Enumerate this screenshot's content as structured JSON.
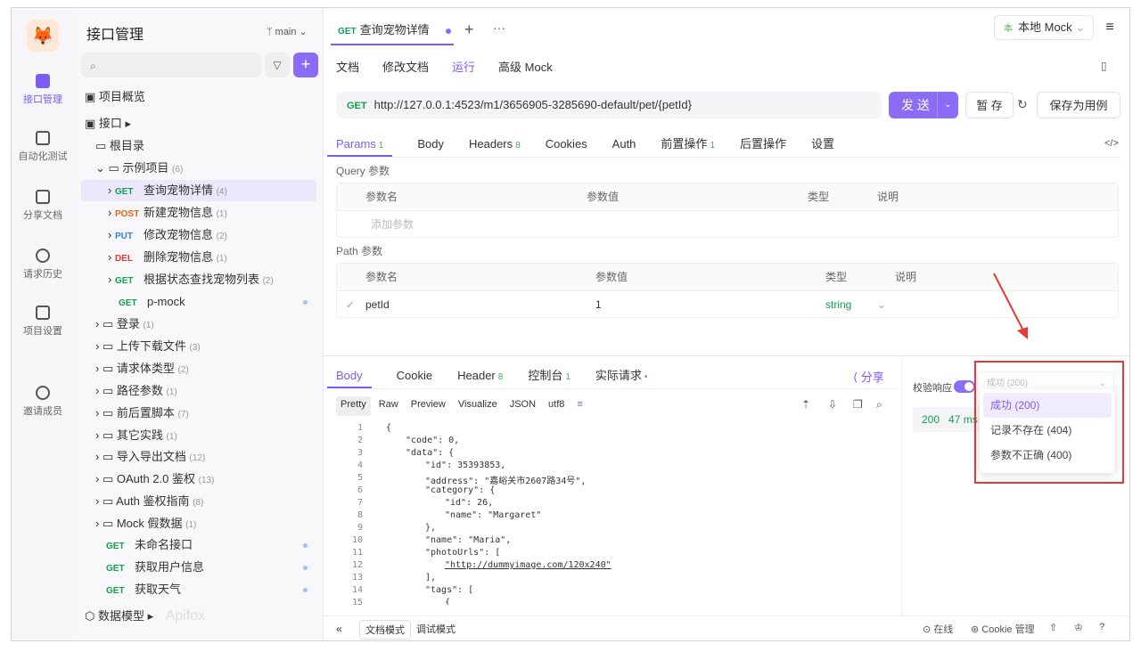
{
  "rail": {
    "items": [
      {
        "label": "接口管理",
        "icon": "api-icon"
      },
      {
        "label": "自动化测试",
        "icon": "automation-icon"
      },
      {
        "label": "分享文档",
        "icon": "share-doc-icon"
      },
      {
        "label": "请求历史",
        "icon": "history-icon"
      },
      {
        "label": "项目设置",
        "icon": "settings-icon"
      },
      {
        "label": "邀请成员",
        "icon": "invite-icon"
      }
    ]
  },
  "sidebar": {
    "title": "接口管理",
    "branch": "main",
    "overview": "项目概览",
    "api_section": "接口",
    "root": "根目录",
    "tree": [
      {
        "label": "示例项目",
        "count": "(6)",
        "type": "folder"
      },
      {
        "method": "GET",
        "label": "查询宠物详情",
        "count": "(4)"
      },
      {
        "method": "POST",
        "label": "新建宠物信息",
        "count": "(1)"
      },
      {
        "method": "PUT",
        "label": "修改宠物信息",
        "count": "(2)"
      },
      {
        "method": "DEL",
        "label": "删除宠物信息",
        "count": "(1)"
      },
      {
        "method": "GET",
        "label": "根据状态查找宠物列表",
        "count": "(2)"
      },
      {
        "method": "GET",
        "label": "p-mock",
        "count": ""
      },
      {
        "label": "登录",
        "count": "(1)"
      },
      {
        "label": "上传下载文件",
        "count": "(3)"
      },
      {
        "label": "请求体类型",
        "count": "(2)"
      },
      {
        "label": "路径参数",
        "count": "(1)"
      },
      {
        "label": "前后置脚本",
        "count": "(7)"
      },
      {
        "label": "其它实践",
        "count": "(1)"
      },
      {
        "label": "导入导出文档",
        "count": "(12)"
      },
      {
        "label": "OAuth 2.0 鉴权",
        "count": "(13)"
      },
      {
        "label": "Auth 鉴权指南",
        "count": "(8)"
      },
      {
        "label": "Mock 假数据",
        "count": "(1)"
      },
      {
        "method": "GET",
        "label": "未命名接口",
        "count": ""
      },
      {
        "method": "GET",
        "label": "获取用户信息",
        "count": ""
      },
      {
        "method": "GET",
        "label": "获取天气",
        "count": ""
      }
    ],
    "data_model": "数据模型",
    "watermark": "Apifox"
  },
  "tab": {
    "method": "GET",
    "label": "查询宠物详情"
  },
  "env": {
    "label": "本地 Mock"
  },
  "subtabs": [
    "文档",
    "修改文档",
    "运行",
    "高级 Mock"
  ],
  "url": {
    "method": "GET",
    "value": "http://127.0.0.1:4523/m1/3656905-3285690-default/pet/{petId}"
  },
  "buttons": {
    "send": "发 送",
    "save": "暂 存",
    "save_case": "保存为用例"
  },
  "reqtabs": [
    {
      "label": "Params",
      "badge": "1"
    },
    {
      "label": "Body",
      "badge": ""
    },
    {
      "label": "Headers",
      "badge": "8"
    },
    {
      "label": "Cookies",
      "badge": ""
    },
    {
      "label": "Auth",
      "badge": ""
    },
    {
      "label": "前置操作",
      "badge": "1"
    },
    {
      "label": "后置操作",
      "badge": ""
    },
    {
      "label": "设置",
      "badge": ""
    }
  ],
  "query": {
    "title": "Query 参数",
    "cols": [
      "参数名",
      "参数值",
      "类型",
      "说明"
    ],
    "placeholder": "添加参数"
  },
  "path": {
    "title": "Path 参数",
    "cols": [
      "参数名",
      "参数值",
      "类型",
      "说明"
    ],
    "row": {
      "name": "petId",
      "value": "1",
      "type": "string"
    }
  },
  "resptabs": [
    {
      "label": "Body",
      "badge": ""
    },
    {
      "label": "Cookie",
      "badge": ""
    },
    {
      "label": "Header",
      "badge": "8"
    },
    {
      "label": "控制台",
      "badge": "1"
    },
    {
      "label": "实际请求",
      "badge": "•"
    }
  ],
  "share": "分享",
  "formats": [
    "Pretty",
    "Raw",
    "Preview",
    "Visualize",
    "JSON",
    "utf8"
  ],
  "code_lines": [
    "{",
    "\"code\": 0,",
    "\"data\": {",
    "\"id\": 35393853,",
    "\"address\": \"嘉峪关市2607路34号\",",
    "\"category\": {",
    "\"id\": 26,",
    "\"name\": \"Margaret\"",
    "},",
    "\"name\": \"Maria\",",
    "\"photoUrls\": [",
    "\"http://dummyimage.com/120x240\"",
    "],",
    "\"tags\": [",
    "{"
  ],
  "validation": {
    "label": "校验响应",
    "selected": "成功 (200)"
  },
  "metrics": {
    "status": "200",
    "time": "47 ms"
  },
  "dropdown": [
    "成功 (200)",
    "记录不存在 (404)",
    "参数不正确 (400)"
  ],
  "bottom": {
    "mode_doc": "文档模式",
    "mode_debug": "调试模式",
    "online": "在线",
    "cookie": "Cookie 管理"
  },
  "colors": {
    "accent": "#8b6cf6",
    "get": "#12a150",
    "post": "#e8650f",
    "put": "#2e7df6",
    "del": "#e53935",
    "highlight": "#e53935"
  }
}
